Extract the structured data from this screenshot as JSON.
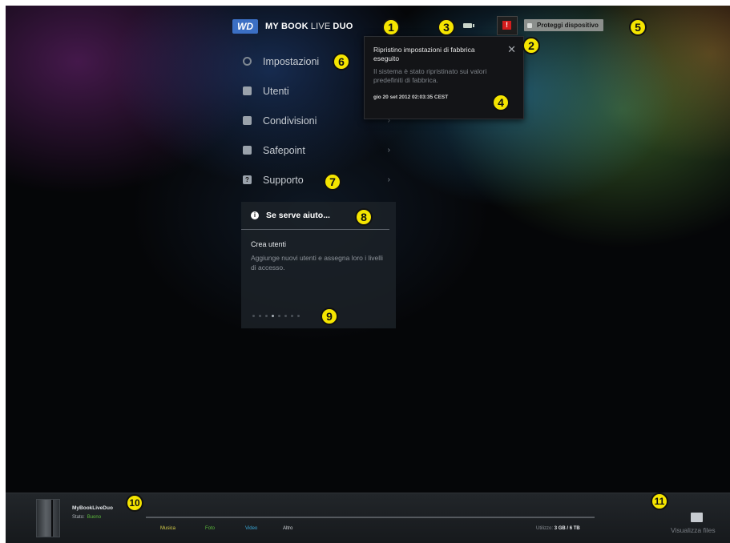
{
  "header": {
    "logo": "WD",
    "product": "MY BOOK",
    "product_tm": "LIVE",
    "product_suffix": "DUO",
    "alert_badge": "!",
    "protect_button": "Proteggi dispositivo"
  },
  "menu": {
    "items": [
      {
        "label": "Impostazioni",
        "icon": "gear-icon"
      },
      {
        "label": "Utenti",
        "icon": "users-icon"
      },
      {
        "label": "Condivisioni",
        "icon": "folder-icon",
        "chevron": "›"
      },
      {
        "label": "Safepoint",
        "icon": "safepoint-icon",
        "chevron": "›"
      },
      {
        "label": "Supporto",
        "icon": "support-icon",
        "chevron": "›"
      }
    ]
  },
  "help": {
    "title": "Se serve aiuto...",
    "tip_title": "Crea utenti",
    "tip_desc": "Aggiunge nuovi utenti e assegna loro i livelli di accesso."
  },
  "notification": {
    "title": "Ripristino impostazioni di fabbrica eseguito",
    "message": "Il sistema è stato ripristinato sui valori predefiniti di fabbrica.",
    "timestamp": "gio 20 set 2012 02:03:35 CEST",
    "close": "✕"
  },
  "footer": {
    "device_name": "MyBookLiveDuo",
    "state_label": "Stato:",
    "state_value": "Buono",
    "legend": [
      {
        "label": "Musica",
        "color": "#d9d04a"
      },
      {
        "label": "Foto",
        "color": "#5dbb3c"
      },
      {
        "label": "Video",
        "color": "#3aa8d8"
      },
      {
        "label": "Altro",
        "color": "#cfd3d6"
      }
    ],
    "used_label": "Utilizzo:",
    "used_value": "3 GB / 6 TB",
    "files_button": "Visualizza files"
  },
  "callouts": [
    "1",
    "2",
    "3",
    "4",
    "5",
    "6",
    "7",
    "8",
    "9",
    "10",
    "11"
  ],
  "colors": {
    "callout": "#f5e500",
    "alert": "#d41d1d",
    "wd_blue": "#3b6fc4"
  }
}
